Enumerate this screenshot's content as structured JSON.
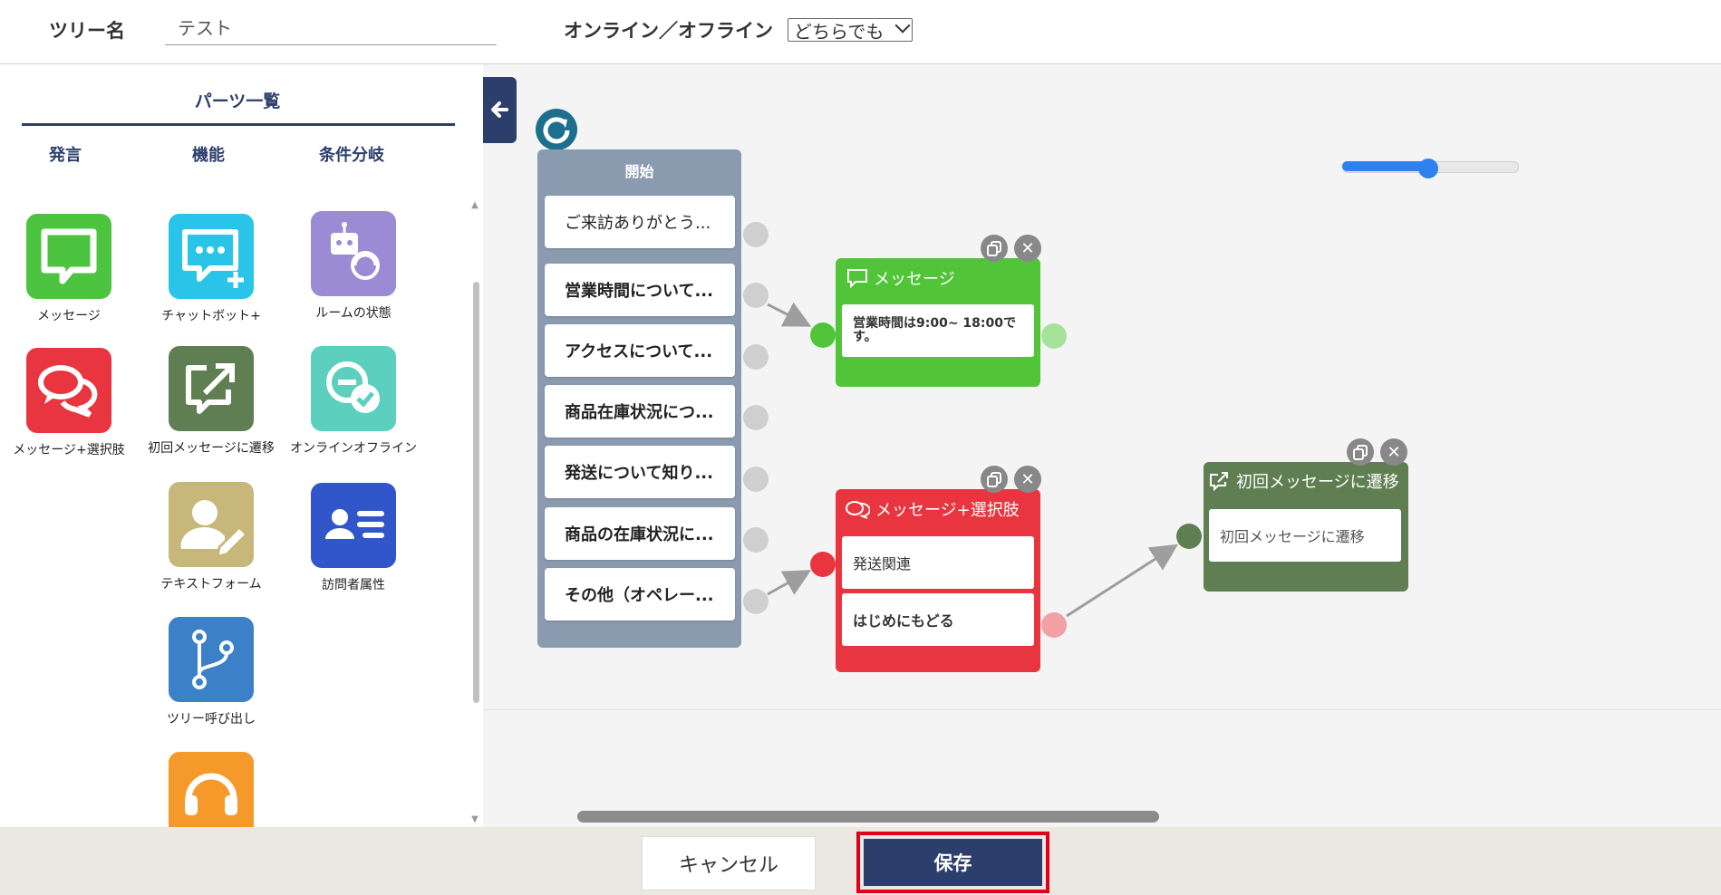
{
  "header": {
    "tree_name_label": "ツリー名",
    "tree_name_value": "テスト",
    "online_label": "オンライン／オフライン",
    "online_select_value": "どちらでも"
  },
  "parts_panel": {
    "title": "パーツ一覧",
    "tabs": [
      "発言",
      "機能",
      "条件分岐"
    ],
    "items": [
      {
        "label": "メッセージ",
        "icon": "speech-bubble-icon",
        "color": "#4cc43f"
      },
      {
        "label": "チャットボット+",
        "icon": "chatbot-plus-icon",
        "color": "#29c4e8"
      },
      {
        "label": "ルームの状態",
        "icon": "robot-operator-icon",
        "color": "#9b8bd4"
      },
      {
        "label": "メッセージ+選択肢",
        "icon": "double-bubble-icon",
        "color": "#e8353f"
      },
      {
        "label": "初回メッセージに遷移",
        "icon": "external-link-icon",
        "color": "#5f7f53"
      },
      {
        "label": "オンラインオフライン",
        "icon": "online-check-icon",
        "color": "#5ccfbf"
      },
      {
        "label": "テキストフォーム",
        "icon": "user-edit-icon",
        "color": "#c8b77a"
      },
      {
        "label": "訪問者属性",
        "icon": "id-card-icon",
        "color": "#3156c9"
      },
      {
        "label": "ツリー呼び出し",
        "icon": "branch-icon",
        "color": "#3c80c8"
      },
      {
        "label": "",
        "icon": "headset-icon",
        "color": "#f59a2a"
      }
    ]
  },
  "canvas": {
    "start_node": {
      "title": "開始",
      "items": [
        "ご来訪ありがとう...",
        "営業時間について...",
        "アクセスについて...",
        "商品在庫状況につ...",
        "発送について知り...",
        "商品の在庫状況に...",
        "その他（オペレー..."
      ]
    },
    "message_node": {
      "title": "メッセージ",
      "body": "営業時間は9:00~ 18:00です。",
      "color": "#52c43a"
    },
    "choice_node": {
      "title": "メッセージ+選択肢",
      "choices": [
        "発送関連",
        "はじめにもどる"
      ],
      "color": "#e8353f"
    },
    "transition_node": {
      "title": "初回メッセージに遷移",
      "body": "初回メッセージに遷移",
      "color": "#5f7f53"
    },
    "zoom_level": 0.5
  },
  "footer": {
    "cancel_label": "キャンセル",
    "save_label": "保存"
  }
}
